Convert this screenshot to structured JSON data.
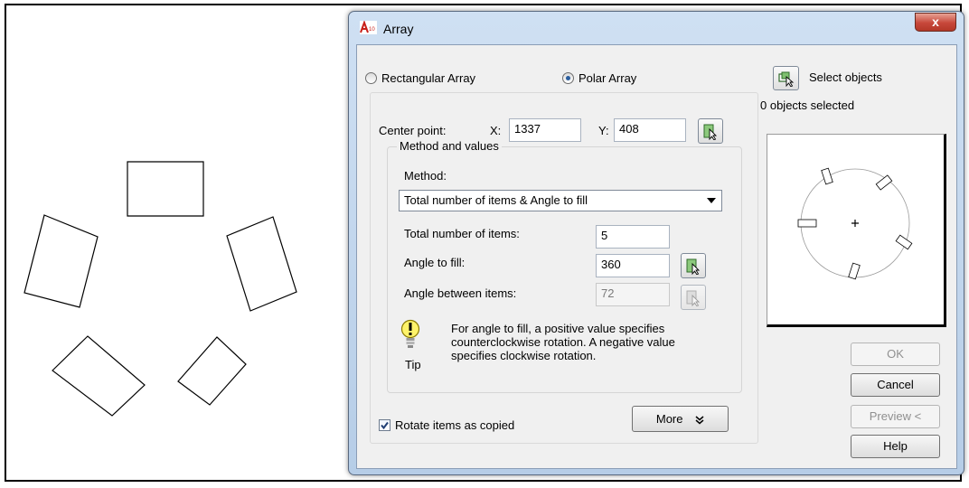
{
  "dialog": {
    "title": "Array",
    "close_label": "x",
    "rectangular_label": "Rectangular Array",
    "polar_label": "Polar Array",
    "select_objects_label": "Select objects",
    "objects_selected": "0 objects selected",
    "center_point_label": "Center point:",
    "x_label": "X:",
    "x_value": "1337",
    "y_label": "Y:",
    "y_value": "408",
    "method_group_label": "Method and values",
    "method_label": "Method:",
    "method_value": "Total number of items & Angle to fill",
    "total_items_label": "Total number of items:",
    "total_items_value": "5",
    "angle_fill_label": "Angle to fill:",
    "angle_fill_value": "360",
    "angle_between_label": "Angle between items:",
    "angle_between_value": "72",
    "tip_text_1": "For angle to fill, a positive value specifies",
    "tip_text_2": "counterclockwise rotation.  A negative value",
    "tip_text_3": "specifies clockwise rotation.",
    "tip_label": "Tip",
    "rotate_label": "Rotate items as copied",
    "more_label": "More",
    "ok_label": "OK",
    "cancel_label": "Cancel",
    "preview_label": "Preview <",
    "help_label": "Help"
  },
  "state": {
    "array_type": "polar",
    "rotate_items": true,
    "angle_between_enabled": false,
    "ok_enabled": false,
    "preview_enabled": false
  },
  "colors": {
    "dialog_frame": "#b6cde7",
    "close_button": "#c7473a",
    "radio_selected": "#2b5e9e",
    "checkbox_mark": "#1f3f74"
  }
}
